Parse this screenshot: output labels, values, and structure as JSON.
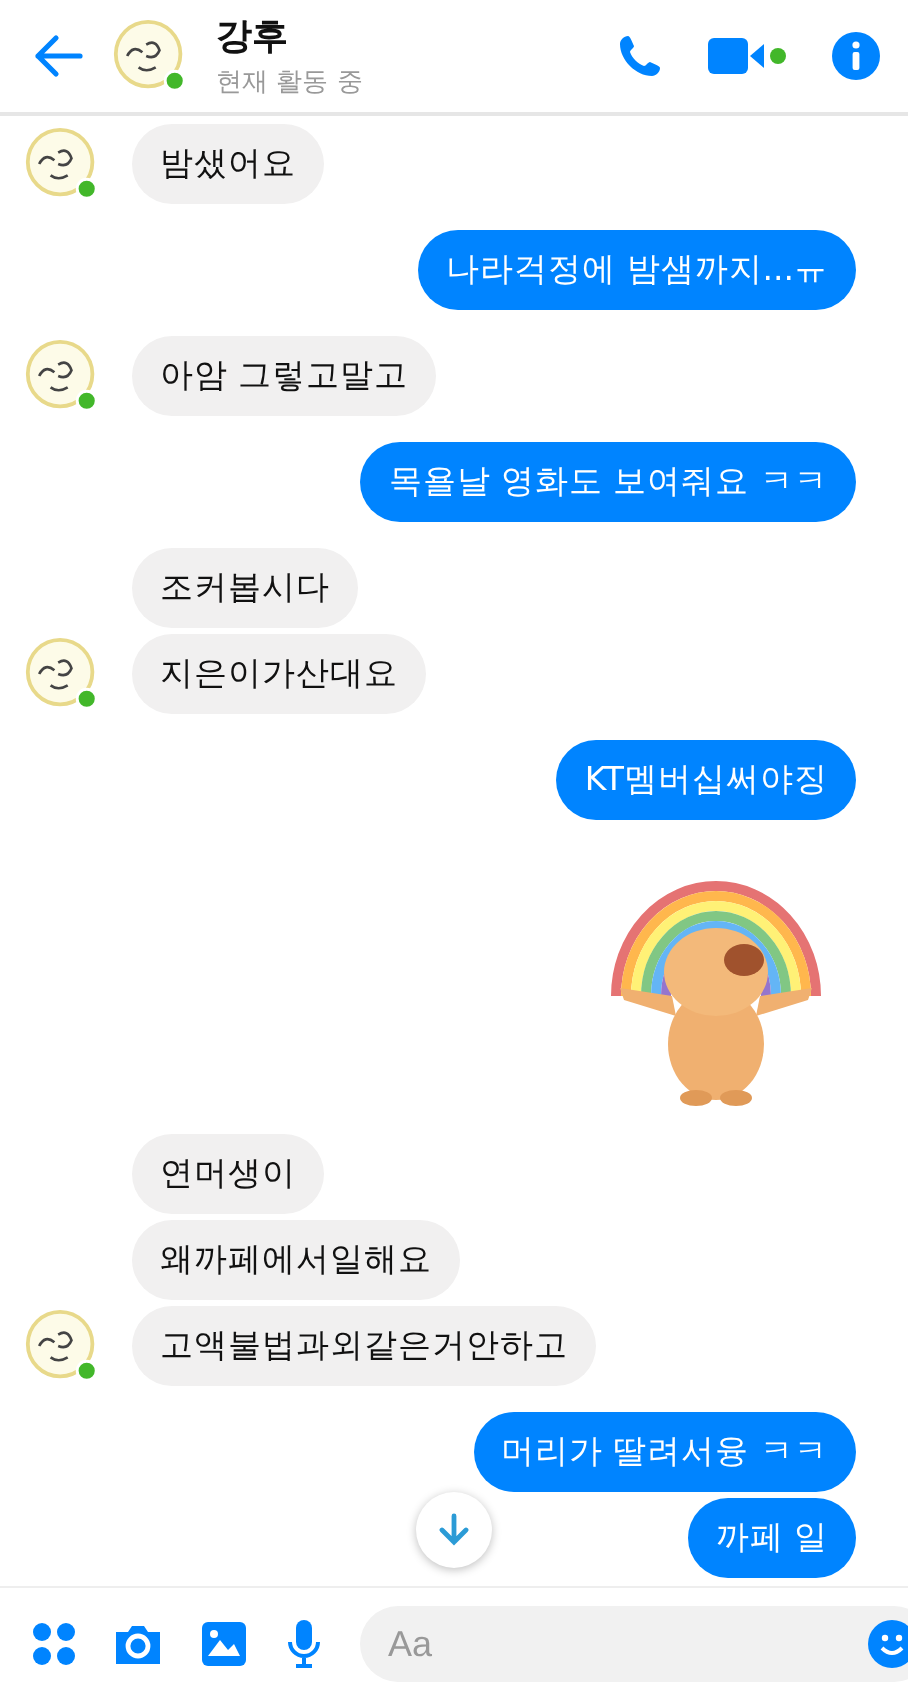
{
  "header": {
    "name": "강후",
    "status": "현재 활동 중",
    "online": true
  },
  "messages": [
    {
      "outgoing": false,
      "kind": "text",
      "text": "밤샜어요",
      "avatar": true
    },
    {
      "outgoing": true,
      "kind": "text",
      "text": "나라걱정에 밤샘까지...ㅠ",
      "avatar": false
    },
    {
      "outgoing": false,
      "kind": "text",
      "text": "아암 그렇고말고",
      "avatar": true
    },
    {
      "outgoing": true,
      "kind": "text",
      "text": "목욜날 영화도 보여줘요 ㅋㅋ",
      "avatar": false
    },
    {
      "outgoing": false,
      "kind": "text",
      "text": "조커봅시다",
      "avatar": false
    },
    {
      "outgoing": false,
      "kind": "text",
      "text": "지은이가산대요",
      "avatar": true
    },
    {
      "outgoing": true,
      "kind": "text",
      "text": "KT멤버십써야징",
      "avatar": false
    },
    {
      "outgoing": true,
      "kind": "sticker",
      "avatar": false
    },
    {
      "outgoing": false,
      "kind": "text",
      "text": "연머생이",
      "avatar": false
    },
    {
      "outgoing": false,
      "kind": "text",
      "text": "왜까페에서일해요",
      "avatar": false
    },
    {
      "outgoing": false,
      "kind": "text",
      "text": "고액불법과외같은거안하고",
      "avatar": true
    },
    {
      "outgoing": true,
      "kind": "text",
      "text": "머리가 딸려서융 ㅋㅋ",
      "avatar": false
    },
    {
      "outgoing": true,
      "kind": "text",
      "text": "까페 일",
      "avatar": false
    }
  ],
  "composer": {
    "placeholder": "Aa"
  }
}
